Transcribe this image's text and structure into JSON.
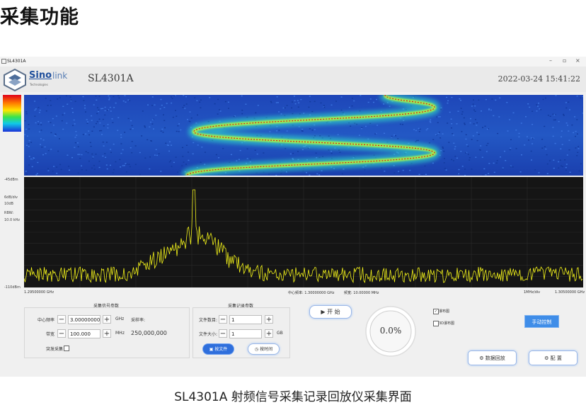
{
  "page": {
    "heading": "采集功能",
    "caption": "SL4301A 射频信号采集记录回放仪采集界面"
  },
  "window": {
    "title": "SL4301A",
    "controls": {
      "minimize": "–",
      "maximize": "▫",
      "close": "×"
    },
    "logo": {
      "brand": "Sino",
      "brand_suffix": "link",
      "tagline": "Technologies"
    },
    "app_name": "SL4301A",
    "datetime": "2022-03-24 15:41:22"
  },
  "display": {
    "colormap": [
      "#e0001a",
      "#ff7a00",
      "#ffe600",
      "#39e34d",
      "#10c9e8",
      "#1a32d8"
    ],
    "y_top_label": "-45dBm",
    "y_bottom_label": "-110dBm",
    "scale_line1": "6dB/div",
    "scale_line2": "10dB",
    "rbw_label": "RBW:",
    "rbw_value": "10.0 kHz",
    "x_start": "1.29500000 GHz",
    "center_label": "中心频率: 1.30000000 GHz",
    "span_label": "频宽: 10.00000 MHz",
    "per_div": "1MHz/div",
    "x_end": "1.30500000 GHz",
    "trace_color": "#f2f21a",
    "track_color": "#d81b1b"
  },
  "signal_params": {
    "title": "采集信号参数",
    "center_freq_label": "中心频率",
    "center_freq_value": "3.00000000",
    "center_freq_unit": "GHz",
    "sample_rate_label": "采样率:",
    "bandwidth_label": "带宽",
    "bandwidth_value": "100.000",
    "bandwidth_unit": "MHz",
    "sample_rate_value": "250,000,000",
    "burst_label": "突发采集"
  },
  "record_params": {
    "title": "采集记录参数",
    "file_count_label": "文件数目:",
    "file_count_value": "1",
    "file_size_label": "文件大小:",
    "file_size_value": "1",
    "file_size_unit": "GB",
    "by_file_label": "按文件",
    "by_time_label": "按时间"
  },
  "controls": {
    "start_label": "开 始",
    "progress_text": "0.0%",
    "progress_fraction": 0.0,
    "waterfall_label": "瀑布图",
    "waterfall_checked": true,
    "waterfall3d_label": "3D瀑布图",
    "waterfall3d_checked": false,
    "manual_label": "手动控制",
    "playback_label": "数据回放",
    "config_label": "配  置"
  },
  "stepper": {
    "minus": "−",
    "plus": "+"
  }
}
